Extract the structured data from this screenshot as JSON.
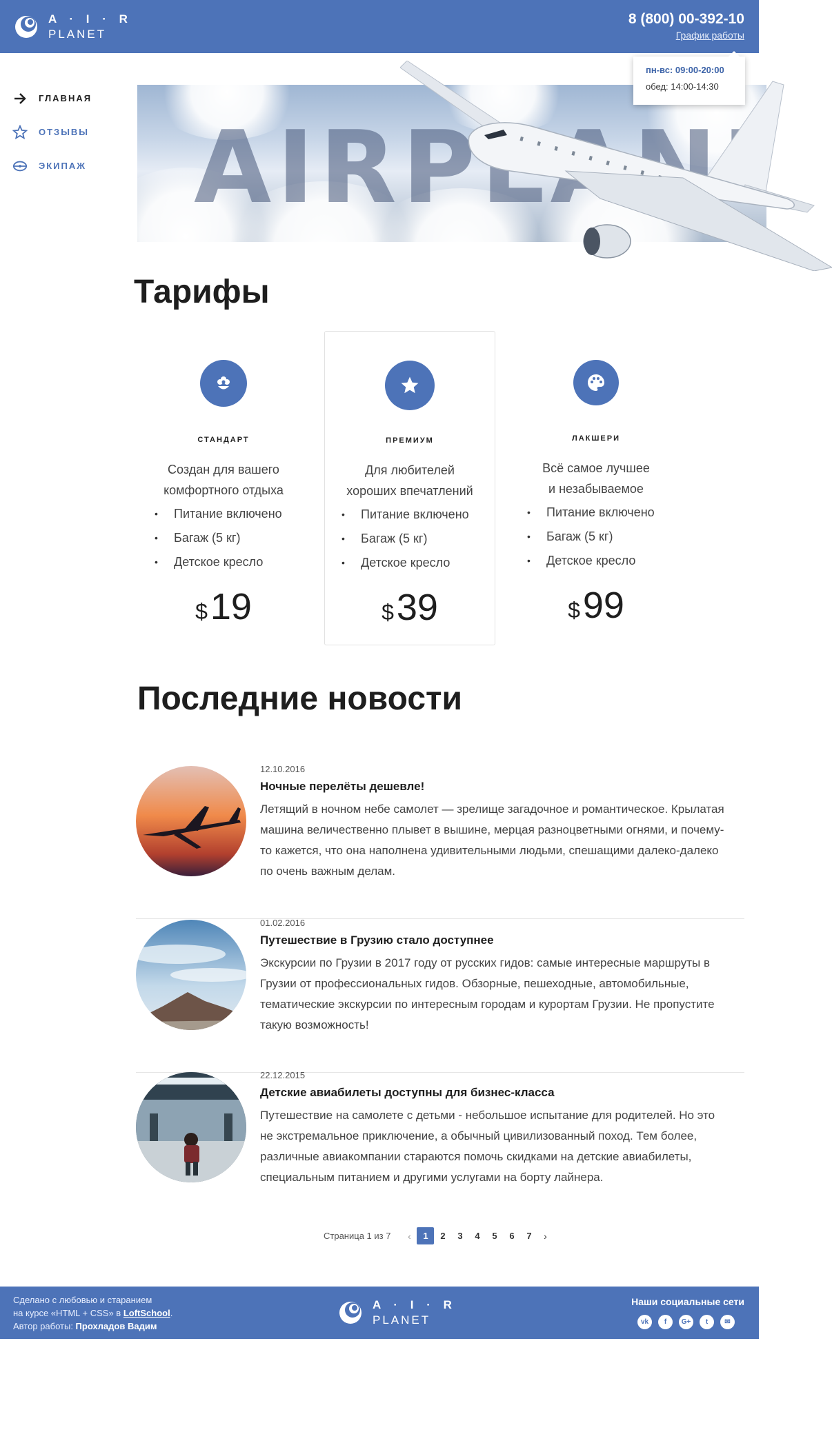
{
  "header": {
    "logo_top": "A · I · R",
    "logo_bottom": "PLANET",
    "phone": "8 (800) 00-392-10",
    "schedule_link": "График работы",
    "tooltip_hours": "пн-вс: 09:00-20:00",
    "tooltip_lunch": "обед: 14:00-14:30"
  },
  "nav": {
    "items": [
      {
        "label": "ГЛАВНАЯ",
        "icon": "arrow-right-icon"
      },
      {
        "label": "ОТЗЫВЫ",
        "icon": "star-icon"
      },
      {
        "label": "ЭКИПАЖ",
        "icon": "cap-icon"
      }
    ]
  },
  "hero": {
    "word": "AIRPLANE"
  },
  "tariffs": {
    "title": "Тарифы",
    "items": [
      {
        "name": "СТАНДАРТ",
        "desc1": "Создан для вашего",
        "desc2": "комфортного отдыха",
        "features": [
          "Питание включено",
          "Багаж (5 кг)",
          "Детское кресло"
        ],
        "currency": "$",
        "price": "19",
        "icon": "flower-icon"
      },
      {
        "name": "ПРЕМИУМ",
        "desc1": "Для любителей",
        "desc2": "хороших впечатлений",
        "features": [
          "Питание включено",
          "Багаж (5 кг)",
          "Детское кресло"
        ],
        "currency": "$",
        "price": "39",
        "icon": "star-icon"
      },
      {
        "name": "ЛАКШЕРИ",
        "desc1": "Всё самое лучшее",
        "desc2": "и незабываемое",
        "features": [
          "Питание включено",
          "Багаж (5 кг)",
          "Детское кресло"
        ],
        "currency": "$",
        "price": "99",
        "icon": "palette-icon"
      }
    ]
  },
  "news": {
    "title": "Последние новости",
    "items": [
      {
        "date": "12.10.2016",
        "title": "Ночные перелёты дешевле!",
        "text": "Летящий в ночном небе самолет — зрелище загадочное и романтическое. Крылатая машина величественно плывет в вышине, мерцая разноцветными огнями, и почему-то кажется, что она наполнена удивительными людьми, спешащими далеко-далеко по очень важным делам."
      },
      {
        "date": "01.02.2016",
        "title": "Путешествие в Грузию стало доступнее",
        "text": "Экскурсии по Грузии в 2017 году от русских гидов: самые интересные маршруты в Грузии от профессиональных гидов. Обзорные, пешеходные, автомобильные, тематические экскурсии по интересным городам и курортам Грузии. Не пропустите такую возможность!"
      },
      {
        "date": "22.12.2015",
        "title": "Детские авиабилеты доступны для бизнес-класса",
        "text": "Путешествие на самолете с детьми - небольшое испытание для родителей. Но это не экстремальное приключение, а обычный цивилизованный поход. Тем более, различные авиакомпании стараются помочь скидками на детские авиабилеты, специальным питанием и другими услугами на борту лайнера."
      }
    ]
  },
  "pagination": {
    "info": "Страница 1 из 7",
    "prev": "‹",
    "next": "›",
    "pages": [
      "1",
      "2",
      "3",
      "4",
      "5",
      "6",
      "7"
    ],
    "current": "1"
  },
  "footer": {
    "line1": "Сделано с любовью и старанием",
    "line2_prefix": "на курсе «HTML + CSS» в ",
    "line2_link": "LoftSchool",
    "line2_suffix": ".",
    "line3_prefix": "Автор работы: ",
    "line3_author": "Прохладов Вадим",
    "social_title": "Наши социальные сети",
    "socials": [
      {
        "label": "vk",
        "icon": "vk-icon"
      },
      {
        "label": "f",
        "icon": "facebook-icon"
      },
      {
        "label": "G+",
        "icon": "google-plus-icon"
      },
      {
        "label": "t",
        "icon": "twitter-icon"
      },
      {
        "label": "✉",
        "icon": "mail-icon"
      }
    ]
  },
  "colors": {
    "brand": "#4d73b8",
    "text": "#222222"
  }
}
